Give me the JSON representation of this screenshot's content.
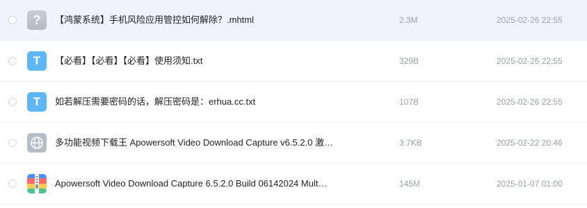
{
  "colors": {
    "selected_row_bg": "#eef3fe",
    "txt_icon_bg": "#5fb6f5",
    "unknown_icon_bg": "#b3b8c2",
    "web_icon_bg": "#b6bcc8",
    "meta_text": "#9aa0aa"
  },
  "files": [
    {
      "name": "【鸿蒙系统】手机风险应用管控如何解除？.mhtml",
      "size": "2.3M",
      "date": "2025-02-26 22:55",
      "icon": "unknown-file-icon",
      "icon_glyph": "?",
      "selected": true
    },
    {
      "name": "【必看】【必看】【必看】使用须知.txt",
      "size": "329B",
      "date": "2025-02-26 22:55",
      "icon": "txt-file-icon",
      "icon_glyph": "T",
      "selected": false
    },
    {
      "name": "如若解压需要密码的话，解压密码是：erhua.cc.txt",
      "size": "107B",
      "date": "2025-02-26 22:55",
      "icon": "txt-file-icon",
      "icon_glyph": "T",
      "selected": false
    },
    {
      "name": "多功能视频下载王 Apowersoft Video Download Capture v6.5.2.0 激…",
      "size": "3.7KB",
      "date": "2025-02-22 20:46",
      "icon": "web-link-file-icon",
      "icon_glyph": "",
      "selected": false
    },
    {
      "name": "Apowersoft Video Download Capture 6.5.2.0 Build 06142024 Mult…",
      "size": "145M",
      "date": "2025-01-07 01:00",
      "icon": "zip-archive-icon",
      "icon_glyph": "",
      "selected": false
    }
  ]
}
